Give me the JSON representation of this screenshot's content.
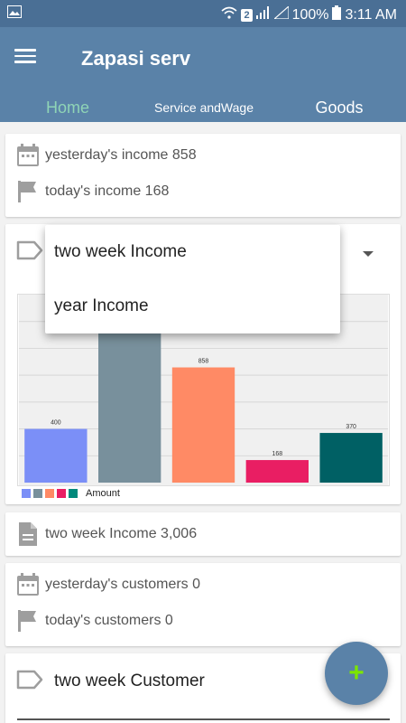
{
  "status_bar": {
    "sim_badge": "2",
    "battery_percent": "100%",
    "time": "3:11 AM"
  },
  "appbar": {
    "title": "Zapasi serv",
    "tabs": [
      {
        "label": "Home"
      },
      {
        "label": "Service andWage"
      },
      {
        "label": "Goods"
      }
    ]
  },
  "summary_income": {
    "yesterday": "yesterday's income 858",
    "today": "today's income 168"
  },
  "chart_card": {
    "selected": "two week Income",
    "legend_label": "Amount"
  },
  "popup": {
    "options": [
      "two week Income",
      "year Income"
    ]
  },
  "income_total": {
    "text": "two week Income 3,006"
  },
  "summary_customers": {
    "yesterday": "yesterday's customers 0",
    "today": "today's customers 0"
  },
  "customer_card": {
    "label": "two week Customer"
  },
  "fab": {
    "label": "+"
  },
  "colors": {
    "status_bar": "#4a6f95",
    "app_bar": "#5a82a8",
    "active_tab": "#8fd4b6",
    "fab_plus": "#7ce600"
  },
  "chart_data": {
    "type": "bar",
    "categories": [
      "",
      "",
      "",
      "",
      ""
    ],
    "series": [
      {
        "name": "Amount",
        "values": [
          400,
          1210,
          858,
          168,
          370
        ]
      }
    ],
    "data_labels": [
      "400",
      "",
      "858",
      "168",
      "370"
    ],
    "colors": [
      "#7b8ff7",
      "#78909c",
      "#ff8a65",
      "#e91e63",
      "#006064"
    ],
    "ylim": [
      0,
      1400
    ],
    "grid": true,
    "legend": "bottom-left"
  }
}
